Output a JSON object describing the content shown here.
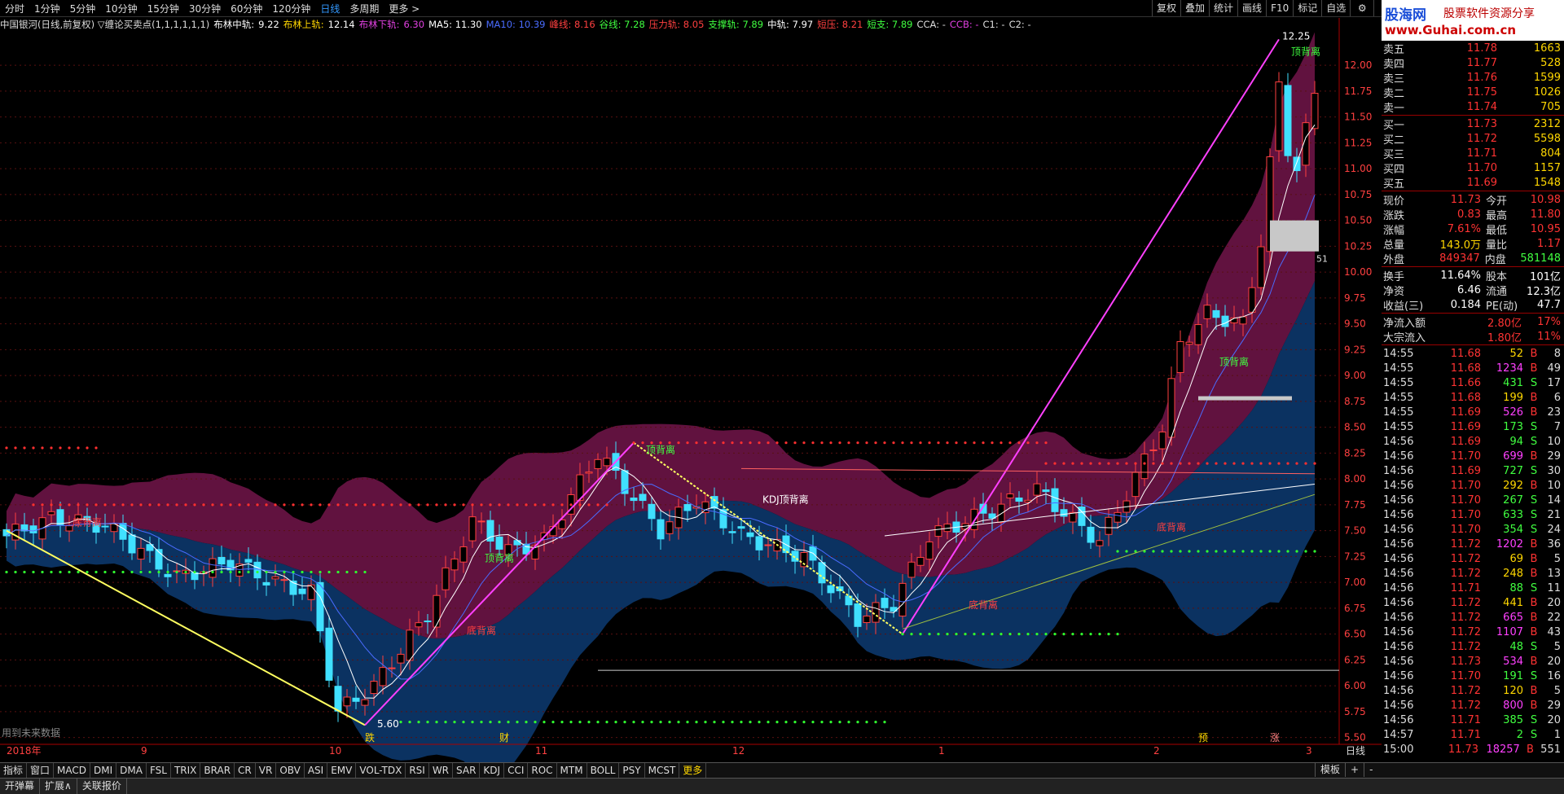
{
  "periods": [
    "分时",
    "1分钟",
    "5分钟",
    "10分钟",
    "15分钟",
    "30分钟",
    "60分钟",
    "120分钟",
    "日线",
    "多周期",
    "更多 >"
  ],
  "active_period": "日线",
  "right_tools": [
    "复权",
    "叠加",
    "统计",
    "画线",
    "F10",
    "标记",
    "自选"
  ],
  "window_icons": {
    "settings": "⚙",
    "close": "✕"
  },
  "logo": {
    "part1": "股海网",
    "part2": "股票软件资源分享",
    "url": "www.Guhai.com.cn"
  },
  "info": [
    {
      "text": "中国银河(日线,前复权) ▽缠论买卖点(1,1,1,1,1,1)",
      "color": "#dddddd"
    },
    {
      "text": "布林中轨:",
      "color": "#ffffff"
    },
    {
      "text": "9.22",
      "color": "#ffffff"
    },
    {
      "text": "布林上轨:",
      "color": "#ffd700"
    },
    {
      "text": "12.14",
      "color": "#ffffff"
    },
    {
      "text": "布林下轨:",
      "color": "#e040e0"
    },
    {
      "text": "6.30",
      "color": "#e040e0"
    },
    {
      "text": "MA5: 11.30",
      "color": "#ffffff"
    },
    {
      "text": "MA10: 10.39",
      "color": "#4a6cff"
    },
    {
      "text": "峰线: 8.16",
      "color": "#ff4040"
    },
    {
      "text": "谷线: 7.28",
      "color": "#40ff40"
    },
    {
      "text": "压力轨: 8.05",
      "color": "#ff4040"
    },
    {
      "text": "支撑轨: 7.89",
      "color": "#40ff40"
    },
    {
      "text": "中轨: 7.97",
      "color": "#ffffff"
    },
    {
      "text": "短压: 8.21",
      "color": "#ff4040"
    },
    {
      "text": "短支: 7.89",
      "color": "#40ff40"
    },
    {
      "text": "CCA: -",
      "color": "#dddddd"
    },
    {
      "text": "CCB: -",
      "color": "#e040e0"
    },
    {
      "text": "C1: -",
      "color": "#dddddd"
    },
    {
      "text": "C2: -",
      "color": "#dddddd"
    }
  ],
  "chart_data": {
    "type": "candlestick",
    "y_ticks": [
      12.0,
      11.75,
      11.5,
      11.25,
      11.0,
      10.75,
      10.5,
      10.25,
      10.0,
      9.75,
      9.5,
      9.25,
      9.0,
      8.75,
      8.5,
      8.25,
      8.0,
      7.75,
      7.5,
      7.25,
      7.0,
      6.75,
      6.5,
      6.25,
      6.0,
      5.75,
      5.5
    ],
    "x_labels": [
      {
        "text": "2018年",
        "i": 0
      },
      {
        "text": "9",
        "i": 15
      },
      {
        "text": "10",
        "i": 36
      },
      {
        "text": "11",
        "i": 59
      },
      {
        "text": "12",
        "i": 81
      },
      {
        "text": "1",
        "i": 104
      },
      {
        "text": "2",
        "i": 128
      },
      {
        "text": "3",
        "i": 145
      }
    ],
    "annotations": [
      {
        "text": "12.25",
        "i": 142,
        "price": 12.25,
        "color": "#ffffff"
      },
      {
        "text": "5.60",
        "i": 41,
        "price": 5.6,
        "color": "#ffffff"
      },
      {
        "text": "KDJ顶背离",
        "i": 84,
        "price": 7.77,
        "color": "#ffffff"
      },
      {
        "text": "顶背离",
        "i": 143,
        "price": 12.1,
        "color": "#40ff40"
      },
      {
        "text": "顶背离",
        "i": 71,
        "price": 8.25,
        "color": "#40ff40"
      },
      {
        "text": "顶背离",
        "i": 53,
        "price": 7.2,
        "color": "#40ff40"
      },
      {
        "text": "顶背离",
        "i": 135,
        "price": 9.1,
        "color": "#40ff40"
      },
      {
        "text": "底背离",
        "i": 51,
        "price": 6.5,
        "color": "#ff4040"
      },
      {
        "text": "底背离",
        "i": 107,
        "price": 6.75,
        "color": "#ff4040"
      },
      {
        "text": "底背离",
        "i": 128,
        "price": 7.5,
        "color": "#ff4040"
      },
      {
        "text": "底背离",
        "i": 7,
        "price": 7.55,
        "color": "#ff4040"
      }
    ],
    "markers": [
      {
        "text": "跌",
        "i": 40,
        "color": "#ffd700"
      },
      {
        "text": "财",
        "i": 55,
        "color": "#ffd700"
      },
      {
        "text": "预",
        "i": 133,
        "color": "#ffd700"
      },
      {
        "text": "涨",
        "i": 141,
        "color": "#ff8080"
      }
    ],
    "note": "用到未来数据",
    "bottom_right_label": "日线",
    "side_value": "51"
  },
  "order_book": {
    "asks": [
      {
        "label": "卖五",
        "price": "11.78",
        "vol": "1663"
      },
      {
        "label": "卖四",
        "price": "11.77",
        "vol": "528"
      },
      {
        "label": "卖三",
        "price": "11.76",
        "vol": "1599"
      },
      {
        "label": "卖二",
        "price": "11.75",
        "vol": "1026"
      },
      {
        "label": "卖一",
        "price": "11.74",
        "vol": "705"
      }
    ],
    "bids": [
      {
        "label": "买一",
        "price": "11.73",
        "vol": "2312"
      },
      {
        "label": "买二",
        "price": "11.72",
        "vol": "5598"
      },
      {
        "label": "买三",
        "price": "11.71",
        "vol": "804"
      },
      {
        "label": "买四",
        "price": "11.70",
        "vol": "1157"
      },
      {
        "label": "买五",
        "price": "11.69",
        "vol": "1548"
      }
    ]
  },
  "quote": [
    {
      "a": "现价",
      "b": "11.73",
      "bc": "#ff3333",
      "c": "今开",
      "d": "10.98",
      "dc": "#ff3333"
    },
    {
      "a": "涨跌",
      "b": "0.83",
      "bc": "#ff3333",
      "c": "最高",
      "d": "11.80",
      "dc": "#ff3333"
    },
    {
      "a": "涨幅",
      "b": "7.61%",
      "bc": "#ff3333",
      "c": "最低",
      "d": "10.95",
      "dc": "#ff3333"
    },
    {
      "a": "总量",
      "b": "143.0万",
      "bc": "#ffd700",
      "c": "量比",
      "d": "1.17",
      "dc": "#ff3333"
    },
    {
      "a": "外盘",
      "b": "849347",
      "bc": "#ff3333",
      "c": "内盘",
      "d": "581148",
      "dc": "#40ff40"
    }
  ],
  "quote2": [
    {
      "a": "换手",
      "b": "11.64%",
      "c": "股本",
      "d": "101亿"
    },
    {
      "a": "净资",
      "b": "6.46",
      "c": "流通",
      "d": "12.3亿"
    },
    {
      "a": "收益(三)",
      "b": "0.184",
      "c": "PE(动)",
      "d": "47.7"
    }
  ],
  "flow": [
    {
      "a": "净流入额",
      "b": "2.80亿",
      "c": "17%"
    },
    {
      "a": "大宗流入",
      "b": "1.80亿",
      "c": "11%"
    }
  ],
  "ticks": [
    [
      "14:55",
      "11.68",
      "52",
      "B",
      "8"
    ],
    [
      "14:55",
      "11.68",
      "1234",
      "B",
      "49"
    ],
    [
      "14:55",
      "11.66",
      "431",
      "S",
      "17"
    ],
    [
      "14:55",
      "11.68",
      "199",
      "B",
      "6"
    ],
    [
      "14:55",
      "11.69",
      "526",
      "B",
      "23"
    ],
    [
      "14:55",
      "11.69",
      "173",
      "S",
      "7"
    ],
    [
      "14:56",
      "11.69",
      "94",
      "S",
      "10"
    ],
    [
      "14:56",
      "11.70",
      "699",
      "B",
      "29"
    ],
    [
      "14:56",
      "11.69",
      "727",
      "S",
      "30"
    ],
    [
      "14:56",
      "11.70",
      "292",
      "B",
      "10"
    ],
    [
      "14:56",
      "11.70",
      "267",
      "S",
      "14"
    ],
    [
      "14:56",
      "11.70",
      "633",
      "S",
      "21"
    ],
    [
      "14:56",
      "11.70",
      "354",
      "S",
      "24"
    ],
    [
      "14:56",
      "11.72",
      "1202",
      "B",
      "36"
    ],
    [
      "14:56",
      "11.72",
      "69",
      "B",
      "5"
    ],
    [
      "14:56",
      "11.72",
      "248",
      "B",
      "13"
    ],
    [
      "14:56",
      "11.71",
      "88",
      "S",
      "11"
    ],
    [
      "14:56",
      "11.72",
      "441",
      "B",
      "20"
    ],
    [
      "14:56",
      "11.72",
      "665",
      "B",
      "22"
    ],
    [
      "14:56",
      "11.72",
      "1107",
      "B",
      "43"
    ],
    [
      "14:56",
      "11.72",
      "48",
      "S",
      "5"
    ],
    [
      "14:56",
      "11.73",
      "534",
      "B",
      "20"
    ],
    [
      "14:56",
      "11.70",
      "191",
      "S",
      "16"
    ],
    [
      "14:56",
      "11.72",
      "120",
      "B",
      "5"
    ],
    [
      "14:56",
      "11.72",
      "800",
      "B",
      "29"
    ],
    [
      "14:56",
      "11.71",
      "385",
      "S",
      "20"
    ],
    [
      "14:57",
      "11.71",
      "2",
      "S",
      "1"
    ],
    [
      "15:00",
      "11.73",
      "18257",
      "B",
      "551"
    ]
  ],
  "indicators": [
    "指标",
    "窗口",
    "MACD",
    "DMI",
    "DMA",
    "FSL",
    "TRIX",
    "BRAR",
    "CR",
    "VR",
    "OBV",
    "ASI",
    "EMV",
    "VOL-TDX",
    "RSI",
    "WR",
    "SAR",
    "KDJ",
    "CCI",
    "ROC",
    "MTM",
    "BOLL",
    "PSY",
    "MCST",
    "更多"
  ],
  "side_buttons": [
    "模板",
    "+",
    "-"
  ],
  "bottom_tabs": [
    "开弹幕",
    "扩展∧",
    "关联报价"
  ]
}
